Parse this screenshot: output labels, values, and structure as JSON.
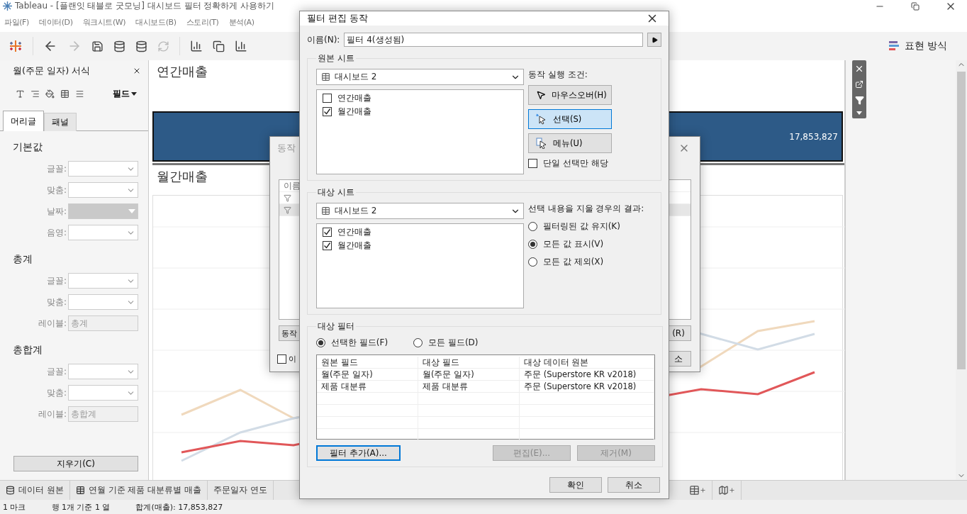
{
  "window": {
    "title": "Tableau - [플랜잇 태블로 굿모닝] 대시보드 필터 정확하게 사용하기"
  },
  "menu": [
    "파일(F)",
    "데이터(D)",
    "워크시트(W)",
    "대시보드(B)",
    "스토리(T)",
    "분석(A)"
  ],
  "presentation_button": "표현 방식",
  "format_panel": {
    "title": "월(주문 일자) 서식",
    "field_menu": "필드",
    "tabs": [
      {
        "label": "머리글",
        "selected": true
      },
      {
        "label": "패널",
        "selected": false
      }
    ],
    "sections": [
      {
        "title": "기본값",
        "rows": [
          {
            "label": "글꼴:",
            "kind": "dropdown",
            "disabled": false
          },
          {
            "label": "맞춤:",
            "kind": "dropdown",
            "disabled": false
          },
          {
            "label": "날짜:",
            "kind": "dropdown",
            "disabled": true
          },
          {
            "label": "음영:",
            "kind": "dropdown",
            "disabled": false
          }
        ]
      },
      {
        "title": "총계",
        "rows": [
          {
            "label": "글꼴:",
            "kind": "dropdown",
            "disabled": false
          },
          {
            "label": "맞춤:",
            "kind": "dropdown",
            "disabled": false
          },
          {
            "label": "레이블:",
            "kind": "text",
            "value": "총계"
          }
        ]
      },
      {
        "title": "총합계",
        "rows": [
          {
            "label": "글꼴:",
            "kind": "dropdown",
            "disabled": false
          },
          {
            "label": "맞춤:",
            "kind": "dropdown",
            "disabled": false
          },
          {
            "label": "레이블:",
            "kind": "text",
            "value": "총합계"
          }
        ]
      }
    ],
    "clear_button": "지우기(C)"
  },
  "dashboard": {
    "annual": {
      "title": "연간매출",
      "value": "17,853,827"
    },
    "monthly": {
      "title": "월간매출"
    }
  },
  "sheet_tabs": [
    {
      "label": "데이터 원본",
      "kind": "datasource"
    },
    {
      "label": "연월 기준 제품 대분류별 매출",
      "kind": "dashboard"
    },
    {
      "label": "주문일자 연도",
      "kind": "sheet"
    }
  ],
  "status_bar": [
    "1 마크",
    "행 1개 기준 1 열",
    "합계(매출): 17,853,827"
  ],
  "actions_dialog": {
    "title": "동작",
    "list_header": "이름",
    "left_button": "동작",
    "right_buttons": [
      "(R)",
      "소"
    ],
    "checkbox": {
      "label": "이",
      "checked": false
    }
  },
  "filter_dialog": {
    "title": "필터 편집 동작",
    "name_label": "이름(N):",
    "name_value": "필터 4(생성됨)",
    "source": {
      "legend": "원본 시트",
      "dropdown": "대시보드 2",
      "sheets": [
        {
          "label": "연간매출",
          "checked": false
        },
        {
          "label": "월간매출",
          "checked": true
        }
      ],
      "run_label": "동작 실행 조건:",
      "triggers": [
        {
          "label": "마우스오버(H)",
          "kind": "hover",
          "selected": false
        },
        {
          "label": "선택(S)",
          "kind": "select",
          "selected": true
        },
        {
          "label": "메뉴(U)",
          "kind": "menu",
          "selected": false
        }
      ],
      "single_select": {
        "label": "단일 선택만 해당",
        "checked": false
      }
    },
    "target": {
      "legend": "대상 시트",
      "dropdown": "대시보드 2",
      "sheets": [
        {
          "label": "연간매출",
          "checked": true
        },
        {
          "label": "월간매출",
          "checked": true
        }
      ],
      "clear_label": "선택 내용을 지울 경우의 결과:",
      "options": [
        {
          "label": "필터링된 값 유지(K)",
          "selected": false
        },
        {
          "label": "모든 값 표시(V)",
          "selected": true
        },
        {
          "label": "모든 값 제외(X)",
          "selected": false
        }
      ]
    },
    "target_filters": {
      "legend": "대상 필터",
      "modes": [
        {
          "label": "선택한 필드(F)",
          "selected": true
        },
        {
          "label": "모든 필드(D)",
          "selected": false
        }
      ],
      "columns": [
        "원본 필드",
        "대상 필드",
        "대상 데이터 원본"
      ],
      "rows": [
        [
          "월(주문 일자)",
          "월(주문 일자)",
          "주문 (Superstore KR v2018)"
        ],
        [
          "제품 대분류",
          "제품 대분류",
          "주문 (Superstore KR v2018)"
        ]
      ],
      "buttons": [
        {
          "label": "필터 추가(A)...",
          "disabled": false,
          "focused": true
        },
        {
          "label": "편집(E)...",
          "disabled": true,
          "focused": false
        },
        {
          "label": "제거(M)",
          "disabled": true,
          "focused": false
        }
      ]
    },
    "buttons": [
      "확인",
      "취소"
    ]
  }
}
